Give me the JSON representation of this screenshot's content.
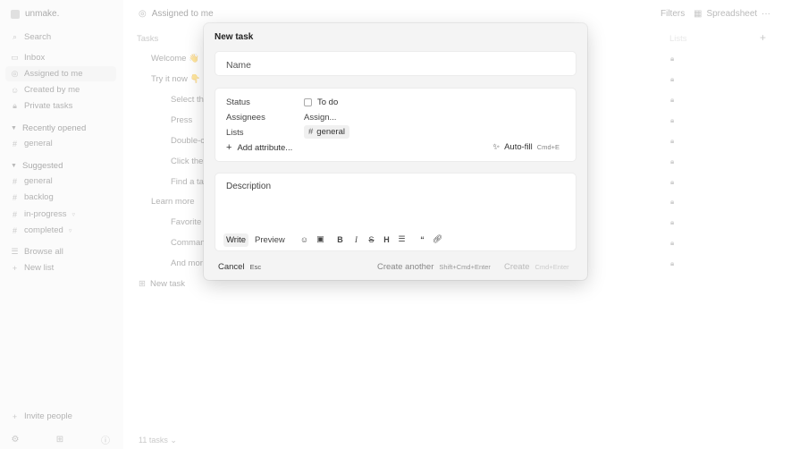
{
  "sidebar": {
    "workspace": "unmake.",
    "search": "Search",
    "items": [
      {
        "label": "Inbox",
        "icon": "inbox-icon"
      },
      {
        "label": "Assigned to me",
        "icon": "target-icon"
      },
      {
        "label": "Created by me",
        "icon": "user-icon"
      },
      {
        "label": "Private tasks",
        "icon": "lock-icon"
      }
    ],
    "recent_title": "Recently opened",
    "recent": [
      {
        "label": "general"
      }
    ],
    "suggested_title": "Suggested",
    "suggested": [
      {
        "label": "general"
      },
      {
        "label": "backlog"
      },
      {
        "label": "in-progress"
      },
      {
        "label": "completed"
      }
    ],
    "browse_all": "Browse all",
    "new_list": "New list",
    "invite": "Invite people"
  },
  "topbar": {
    "title": "Assigned to me",
    "filters": "Filters",
    "view": "Spreadsheet",
    "more": "···"
  },
  "columns": {
    "tasks": "Tasks",
    "lists": "Lists"
  },
  "tasks": [
    {
      "title": "Welcome 👋"
    },
    {
      "title": "Try it now 👇"
    },
    {
      "title": "Select th"
    },
    {
      "title": "Press"
    },
    {
      "title": "Double-c"
    },
    {
      "title": "Click the"
    },
    {
      "title": "Find a ta"
    },
    {
      "title": "Learn more"
    },
    {
      "title": "Favorite"
    },
    {
      "title": "Comman"
    },
    {
      "title": "And mor"
    }
  ],
  "new_task": "New task",
  "task_count": "11 tasks",
  "modal": {
    "title": "New task",
    "name_placeholder": "Name",
    "status_label": "Status",
    "status_value": "To do",
    "assignees_label": "Assignees",
    "assignees_value": "Assign...",
    "lists_label": "Lists",
    "lists_value": "general",
    "add_attribute": "Add attribute...",
    "autofill": "Auto-fill",
    "autofill_shortcut": "Cmd+E",
    "description_placeholder": "Description",
    "tab_write": "Write",
    "tab_preview": "Preview",
    "cancel": "Cancel",
    "cancel_shortcut": "Esc",
    "create_another": "Create another",
    "create_another_shortcut": "Shift+Cmd+Enter",
    "create": "Create",
    "create_shortcut": "Cmd+Enter"
  }
}
